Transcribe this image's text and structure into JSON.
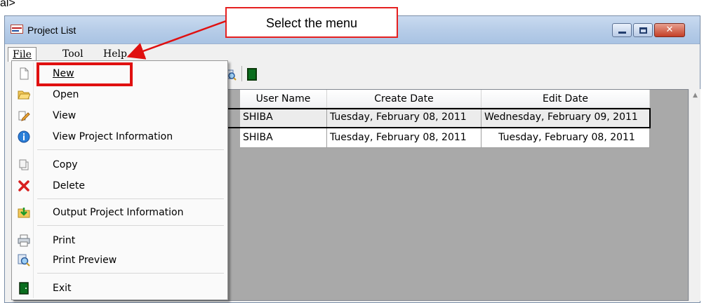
{
  "page": {
    "corner_text": "al>"
  },
  "window": {
    "title": "Project List",
    "controls": {
      "minimize": "minimize",
      "maximize": "maximize",
      "close": "close"
    }
  },
  "menubar": {
    "file": "File",
    "tool": "Tool",
    "help": "Help"
  },
  "annotation": {
    "callout_text": "Select the menu",
    "color": "#e52020"
  },
  "file_menu": {
    "items": [
      {
        "label": "New",
        "icon": "new-document-icon"
      },
      {
        "label": "Open",
        "icon": "open-folder-icon"
      },
      {
        "label": "View",
        "icon": "view-pencil-icon"
      },
      {
        "label": "View Project Information",
        "icon": "info-icon"
      },
      {
        "label": "Copy",
        "icon": "copy-icon"
      },
      {
        "label": "Delete",
        "icon": "delete-x-icon"
      },
      {
        "label": "Output Project Information",
        "icon": "output-folder-icon"
      },
      {
        "label": "Print",
        "icon": "printer-icon"
      },
      {
        "label": "Print Preview",
        "icon": "print-preview-icon"
      },
      {
        "label": "Exit",
        "icon": "exit-door-icon"
      }
    ]
  },
  "table": {
    "headers": {
      "user_name": "User Name",
      "create_date": "Create Date",
      "edit_date": "Edit Date"
    },
    "rows": [
      {
        "user_name": "SHIBA",
        "create_date": "Tuesday, February 08, 2011",
        "edit_date": "Wednesday, February 09, 2011"
      },
      {
        "user_name": "SHIBA",
        "create_date": "Tuesday, February 08, 2011",
        "edit_date": "Tuesday, February 08, 2011"
      }
    ]
  },
  "colors": {
    "titlebar": "#b7cde8",
    "grid_background": "#a9a9a9",
    "highlight_red": "#e01010",
    "exit_green": "#0a6e1e"
  }
}
